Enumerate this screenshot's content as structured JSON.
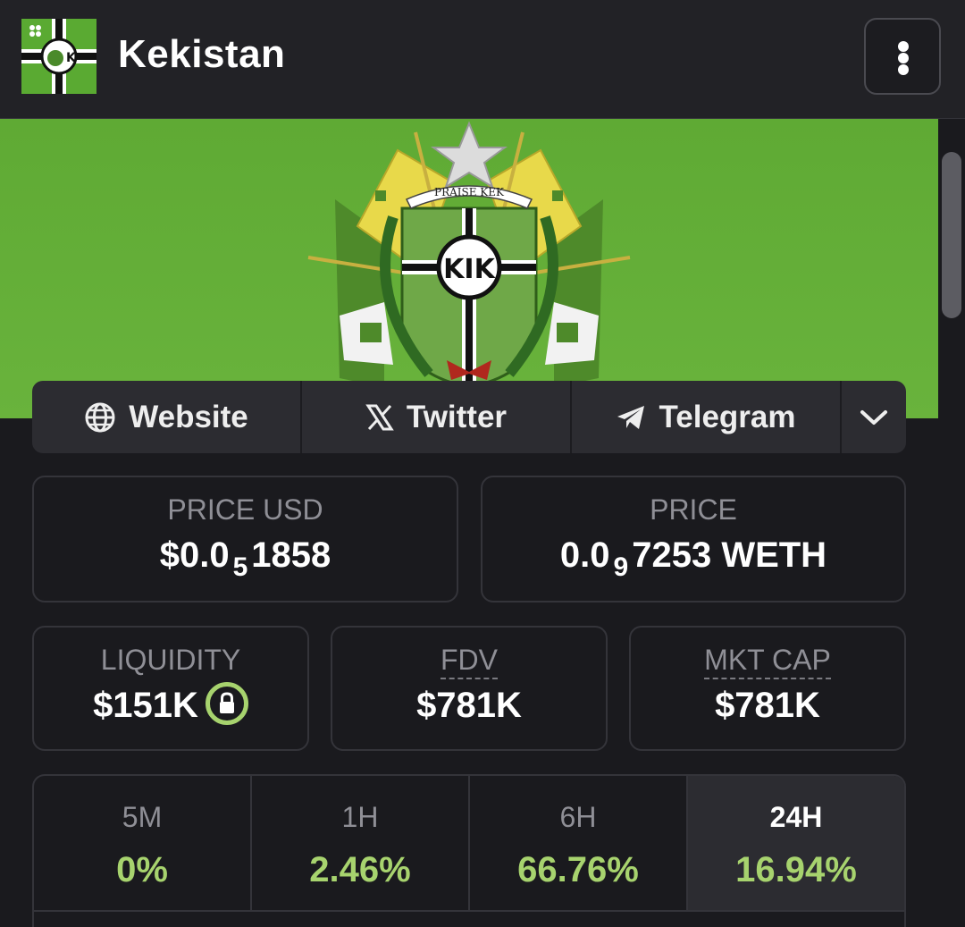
{
  "header": {
    "title": "Kekistan",
    "logo_icon": "kekistan-flag-icon",
    "menu_icon": "vertical-dots-icon"
  },
  "banner": {
    "motto": "PRAISE KEK",
    "emblem_icon": "kekistan-coat-of-arms"
  },
  "links": [
    {
      "label": "Website",
      "icon": "globe-icon"
    },
    {
      "label": "Twitter",
      "icon": "x-logo-icon"
    },
    {
      "label": "Telegram",
      "icon": "telegram-icon"
    }
  ],
  "price_usd": {
    "label": "PRICE USD",
    "prefix": "$0.0",
    "zeros": "5",
    "digits": "1858"
  },
  "price": {
    "label": "PRICE",
    "prefix": "0.0",
    "zeros": "9",
    "digits": "7253 WETH"
  },
  "liquidity": {
    "label": "LIQUIDITY",
    "value": "$151K",
    "icon": "lock-icon"
  },
  "fdv": {
    "label": "FDV",
    "value": "$781K"
  },
  "mkt_cap": {
    "label": "MKT CAP",
    "value": "$781K"
  },
  "timeframes": [
    {
      "label": "5M",
      "value": "0%"
    },
    {
      "label": "1H",
      "value": "2.46%"
    },
    {
      "label": "6H",
      "value": "66.76%"
    },
    {
      "label": "24H",
      "value": "16.94%",
      "active": true
    }
  ],
  "colors": {
    "accent_green": "#a7d36e",
    "banner_green": "#5faa34",
    "background": "#1a1a1e"
  }
}
